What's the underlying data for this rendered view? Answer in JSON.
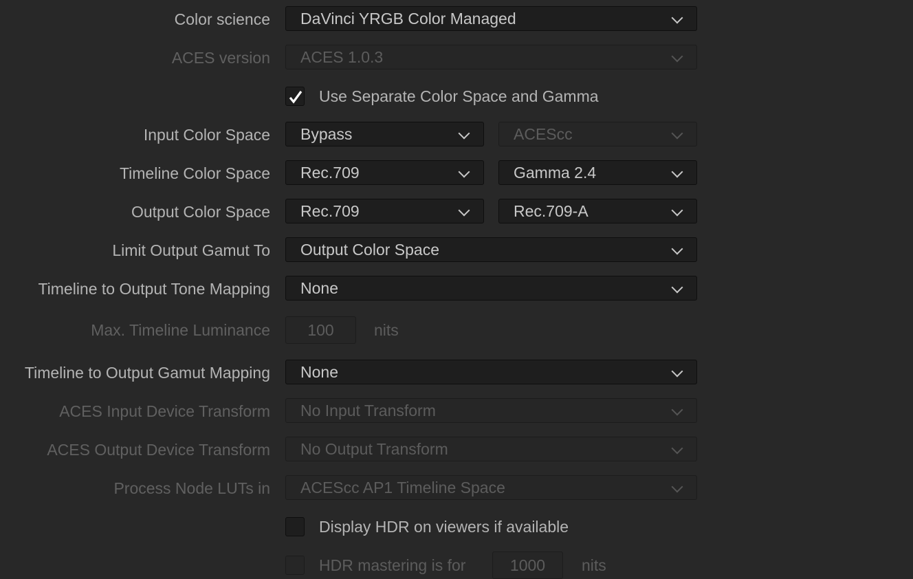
{
  "rows": {
    "color_science": {
      "label": "Color science",
      "value": "DaVinci YRGB Color Managed"
    },
    "aces_version": {
      "label": "ACES version",
      "value": "ACES 1.0.3"
    },
    "separate": {
      "label": "Use Separate Color Space and Gamma",
      "checked": true
    },
    "input": {
      "label": "Input Color Space",
      "space": "Bypass",
      "gamma": "ACEScc"
    },
    "timeline": {
      "label": "Timeline Color Space",
      "space": "Rec.709",
      "gamma": "Gamma 2.4"
    },
    "output": {
      "label": "Output Color Space",
      "space": "Rec.709",
      "gamma": "Rec.709-A"
    },
    "limit": {
      "label": "Limit Output Gamut To",
      "value": "Output Color Space"
    },
    "tone": {
      "label": "Timeline to Output Tone Mapping",
      "value": "None"
    },
    "maxlum": {
      "label": "Max. Timeline Luminance",
      "value": "100",
      "unit": "nits"
    },
    "gamut": {
      "label": "Timeline to Output Gamut Mapping",
      "value": "None"
    },
    "aces_idt": {
      "label": "ACES Input Device Transform",
      "value": "No Input Transform"
    },
    "aces_odt": {
      "label": "ACES Output Device Transform",
      "value": "No Output Transform"
    },
    "luts": {
      "label": "Process Node LUTs in",
      "value": "ACEScc AP1 Timeline Space"
    },
    "hdr": {
      "label": "Display HDR on viewers if available",
      "checked": false
    },
    "hdr_master": {
      "label": "HDR mastering is for",
      "value": "1000",
      "unit": "nits",
      "checked": false
    }
  }
}
